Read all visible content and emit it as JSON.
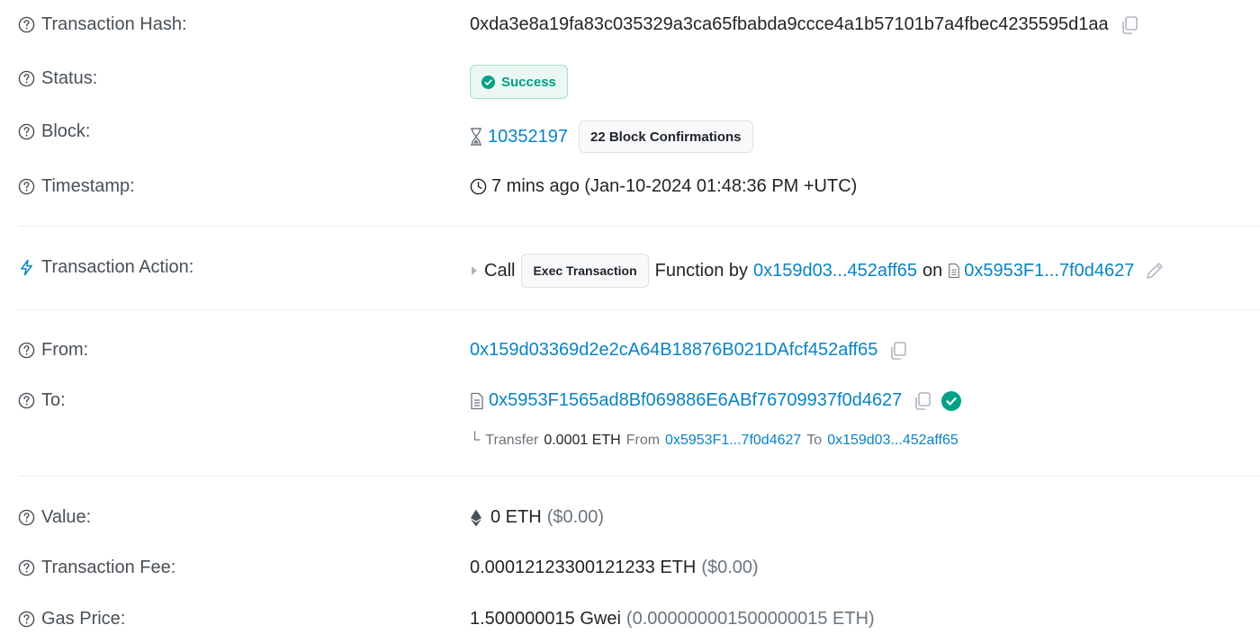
{
  "rows": {
    "tx_hash": {
      "label": "Transaction Hash:",
      "value": "0xda3e8a19fa83c035329a3ca65fbabda9ccce4a1b57101b7a4fbec4235595d1aa"
    },
    "status": {
      "label": "Status:",
      "value": "Success"
    },
    "block": {
      "label": "Block:",
      "number": "10352197",
      "confirmations": "22 Block Confirmations"
    },
    "timestamp": {
      "label": "Timestamp:",
      "value": "7 mins ago (Jan-10-2024 01:48:36 PM +UTC)"
    },
    "action": {
      "label": "Transaction Action:",
      "call": "Call",
      "method": "Exec Transaction",
      "function_by": "Function by",
      "from_short": "0x159d03...452aff65",
      "on": "on",
      "contract_short": "0x5953F1...7f0d4627"
    },
    "from": {
      "label": "From:",
      "address": "0x159d03369d2e2cA64B18876B021DAfcf452aff65"
    },
    "to": {
      "label": "To:",
      "address": "0x5953F1565ad8Bf069886E6ABf76709937f0d4627",
      "transfer": {
        "prefix": "Transfer",
        "amount": "0.0001 ETH",
        "from_word": "From",
        "from_addr": "0x5953F1...7f0d4627",
        "to_word": "To",
        "to_addr": "0x159d03...452aff65"
      }
    },
    "value": {
      "label": "Value:",
      "eth": "0 ETH",
      "usd": "($0.00)"
    },
    "fee": {
      "label": "Transaction Fee:",
      "eth": "0.00012123300121233 ETH",
      "usd": "($0.00)"
    },
    "gas": {
      "label": "Gas Price:",
      "gwei": "1.500000015 Gwei",
      "eth": "(0.000000001500000015 ETH)"
    }
  },
  "icons": {
    "help": "question-circle-icon",
    "copy": "copy-icon",
    "success": "check-circle-icon",
    "hourglass": "hourglass-icon",
    "clock": "clock-icon",
    "lightning": "lightning-icon",
    "caret": "caret-right-icon",
    "document": "document-icon",
    "pencil": "pencil-icon",
    "ethereum": "ethereum-icon"
  },
  "colors": {
    "link": "#0784c3",
    "success": "#00a186",
    "verified": "#00a186"
  }
}
